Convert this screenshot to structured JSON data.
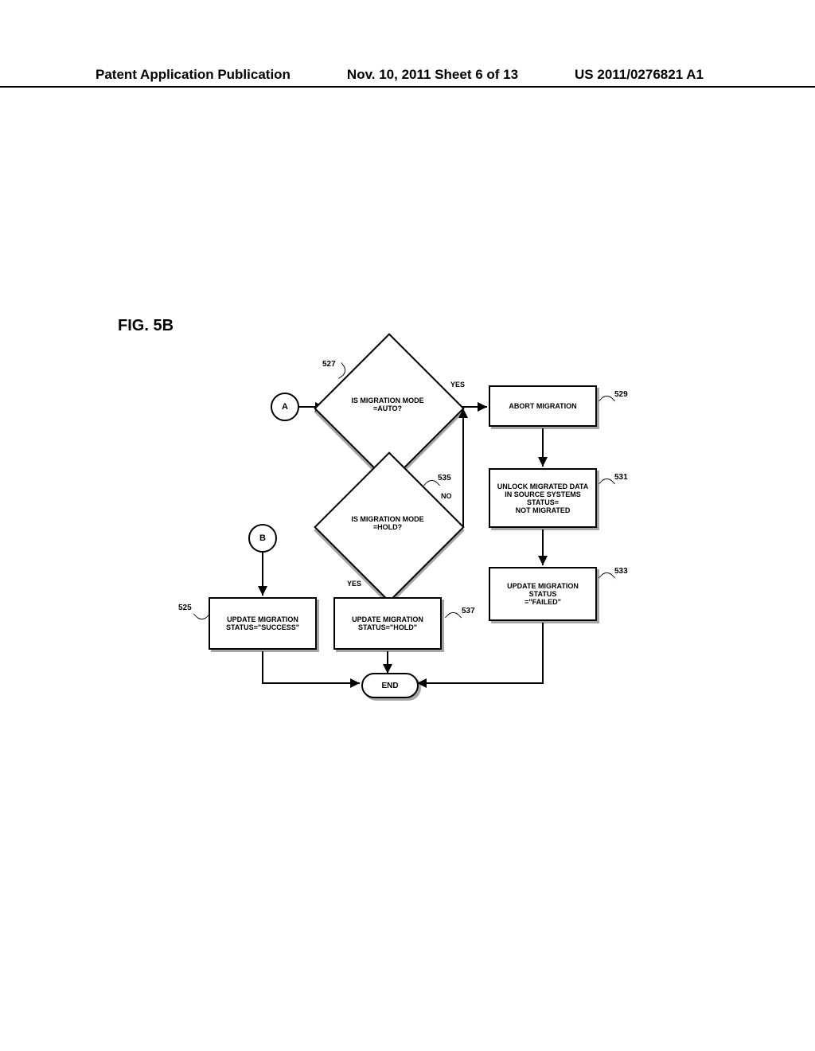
{
  "header": {
    "left": "Patent Application Publication",
    "center": "Nov. 10, 2011  Sheet 6 of 13",
    "right": "US 2011/0276821 A1"
  },
  "figure_label": "FIG. 5B",
  "connectors": {
    "A": "A",
    "B": "B"
  },
  "decisions": {
    "d527": "IS MIGRATION MODE\n=AUTO?",
    "d535": "IS MIGRATION MODE\n=HOLD?"
  },
  "processes": {
    "p529": "ABORT MIGRATION",
    "p531": "UNLOCK MIGRATED DATA\nIN SOURCE SYSTEMS\nSTATUS=\nNOT MIGRATED",
    "p533": "UPDATE MIGRATION\nSTATUS\n=\"FAILED\"",
    "p537": "UPDATE MIGRATION\nSTATUS=\"HOLD\"",
    "p525": "UPDATE MIGRATION\nSTATUS=\"SUCCESS\""
  },
  "terminator": {
    "end": "END"
  },
  "edge_labels": {
    "yes": "YES",
    "no": "NO"
  },
  "reference_numbers": {
    "r525": "525",
    "r527": "527",
    "r529": "529",
    "r531": "531",
    "r533": "533",
    "r535": "535",
    "r537": "537"
  },
  "chart_data": {
    "type": "flowchart",
    "title": "FIG. 5B",
    "nodes": [
      {
        "id": "A",
        "type": "connector",
        "label": "A"
      },
      {
        "id": "B",
        "type": "connector",
        "label": "B"
      },
      {
        "id": "527",
        "type": "decision",
        "label": "IS MIGRATION MODE =AUTO?"
      },
      {
        "id": "535",
        "type": "decision",
        "label": "IS MIGRATION MODE =HOLD?"
      },
      {
        "id": "529",
        "type": "process",
        "label": "ABORT MIGRATION"
      },
      {
        "id": "531",
        "type": "process",
        "label": "UNLOCK MIGRATED DATA IN SOURCE SYSTEMS STATUS= NOT MIGRATED"
      },
      {
        "id": "533",
        "type": "process",
        "label": "UPDATE MIGRATION STATUS =\"FAILED\""
      },
      {
        "id": "537",
        "type": "process",
        "label": "UPDATE MIGRATION STATUS=\"HOLD\""
      },
      {
        "id": "525",
        "type": "process",
        "label": "UPDATE MIGRATION STATUS=\"SUCCESS\""
      },
      {
        "id": "END",
        "type": "terminator",
        "label": "END"
      }
    ],
    "edges": [
      {
        "from": "A",
        "to": "527"
      },
      {
        "from": "527",
        "to": "529",
        "label": "YES"
      },
      {
        "from": "527",
        "to": "535",
        "label": "NO"
      },
      {
        "from": "535",
        "to": "531",
        "label": "NO",
        "via": "527-right-path"
      },
      {
        "from": "535",
        "to": "537",
        "label": "YES"
      },
      {
        "from": "529",
        "to": "531"
      },
      {
        "from": "531",
        "to": "533"
      },
      {
        "from": "B",
        "to": "525"
      },
      {
        "from": "525",
        "to": "END"
      },
      {
        "from": "537",
        "to": "END"
      },
      {
        "from": "533",
        "to": "END"
      }
    ]
  }
}
